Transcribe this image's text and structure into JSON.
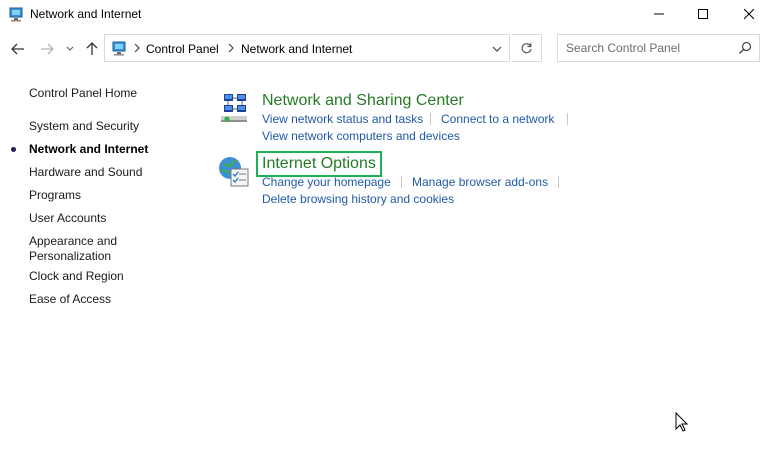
{
  "window": {
    "title": "Network and Internet"
  },
  "address_bar": {
    "breadcrumbs": [
      "Control Panel",
      "Network and Internet"
    ]
  },
  "search": {
    "placeholder": "Search Control Panel"
  },
  "sidebar": {
    "home": "Control Panel Home",
    "items": [
      {
        "label": "System and Security",
        "active": false
      },
      {
        "label": "Network and Internet",
        "active": true
      },
      {
        "label": "Hardware and Sound",
        "active": false
      },
      {
        "label": "Programs",
        "active": false
      },
      {
        "label": "User Accounts",
        "active": false
      },
      {
        "label": "Appearance and",
        "label2": "Personalization",
        "active": false
      },
      {
        "label": "Clock and Region",
        "active": false
      },
      {
        "label": "Ease of Access",
        "active": false
      }
    ]
  },
  "categories": [
    {
      "title": "Network and Sharing Center",
      "tasks": [
        "View network status and tasks",
        "Connect to a network",
        "View network computers and devices"
      ]
    },
    {
      "title": "Internet Options",
      "tasks": [
        "Change your homepage",
        "Manage browser add-ons",
        "Delete browsing history and cookies"
      ]
    }
  ],
  "colors": {
    "category_title": "#267a26",
    "task_link": "#1f5aa6",
    "highlight_box": "#1fb055"
  }
}
